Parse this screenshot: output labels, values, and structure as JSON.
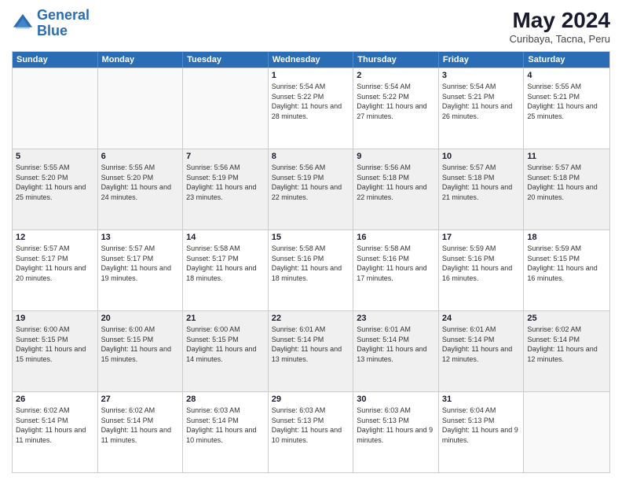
{
  "logo": {
    "line1": "General",
    "line2": "Blue"
  },
  "header": {
    "title": "May 2024",
    "subtitle": "Curibaya, Tacna, Peru"
  },
  "weekdays": [
    "Sunday",
    "Monday",
    "Tuesday",
    "Wednesday",
    "Thursday",
    "Friday",
    "Saturday"
  ],
  "rows": [
    [
      {
        "day": "",
        "sunrise": "",
        "sunset": "",
        "daylight": "",
        "empty": true
      },
      {
        "day": "",
        "sunrise": "",
        "sunset": "",
        "daylight": "",
        "empty": true
      },
      {
        "day": "",
        "sunrise": "",
        "sunset": "",
        "daylight": "",
        "empty": true
      },
      {
        "day": "1",
        "sunrise": "Sunrise: 5:54 AM",
        "sunset": "Sunset: 5:22 PM",
        "daylight": "Daylight: 11 hours and 28 minutes."
      },
      {
        "day": "2",
        "sunrise": "Sunrise: 5:54 AM",
        "sunset": "Sunset: 5:22 PM",
        "daylight": "Daylight: 11 hours and 27 minutes."
      },
      {
        "day": "3",
        "sunrise": "Sunrise: 5:54 AM",
        "sunset": "Sunset: 5:21 PM",
        "daylight": "Daylight: 11 hours and 26 minutes."
      },
      {
        "day": "4",
        "sunrise": "Sunrise: 5:55 AM",
        "sunset": "Sunset: 5:21 PM",
        "daylight": "Daylight: 11 hours and 25 minutes."
      }
    ],
    [
      {
        "day": "5",
        "sunrise": "Sunrise: 5:55 AM",
        "sunset": "Sunset: 5:20 PM",
        "daylight": "Daylight: 11 hours and 25 minutes."
      },
      {
        "day": "6",
        "sunrise": "Sunrise: 5:55 AM",
        "sunset": "Sunset: 5:20 PM",
        "daylight": "Daylight: 11 hours and 24 minutes."
      },
      {
        "day": "7",
        "sunrise": "Sunrise: 5:56 AM",
        "sunset": "Sunset: 5:19 PM",
        "daylight": "Daylight: 11 hours and 23 minutes."
      },
      {
        "day": "8",
        "sunrise": "Sunrise: 5:56 AM",
        "sunset": "Sunset: 5:19 PM",
        "daylight": "Daylight: 11 hours and 22 minutes."
      },
      {
        "day": "9",
        "sunrise": "Sunrise: 5:56 AM",
        "sunset": "Sunset: 5:18 PM",
        "daylight": "Daylight: 11 hours and 22 minutes."
      },
      {
        "day": "10",
        "sunrise": "Sunrise: 5:57 AM",
        "sunset": "Sunset: 5:18 PM",
        "daylight": "Daylight: 11 hours and 21 minutes."
      },
      {
        "day": "11",
        "sunrise": "Sunrise: 5:57 AM",
        "sunset": "Sunset: 5:18 PM",
        "daylight": "Daylight: 11 hours and 20 minutes."
      }
    ],
    [
      {
        "day": "12",
        "sunrise": "Sunrise: 5:57 AM",
        "sunset": "Sunset: 5:17 PM",
        "daylight": "Daylight: 11 hours and 20 minutes."
      },
      {
        "day": "13",
        "sunrise": "Sunrise: 5:57 AM",
        "sunset": "Sunset: 5:17 PM",
        "daylight": "Daylight: 11 hours and 19 minutes."
      },
      {
        "day": "14",
        "sunrise": "Sunrise: 5:58 AM",
        "sunset": "Sunset: 5:17 PM",
        "daylight": "Daylight: 11 hours and 18 minutes."
      },
      {
        "day": "15",
        "sunrise": "Sunrise: 5:58 AM",
        "sunset": "Sunset: 5:16 PM",
        "daylight": "Daylight: 11 hours and 18 minutes."
      },
      {
        "day": "16",
        "sunrise": "Sunrise: 5:58 AM",
        "sunset": "Sunset: 5:16 PM",
        "daylight": "Daylight: 11 hours and 17 minutes."
      },
      {
        "day": "17",
        "sunrise": "Sunrise: 5:59 AM",
        "sunset": "Sunset: 5:16 PM",
        "daylight": "Daylight: 11 hours and 16 minutes."
      },
      {
        "day": "18",
        "sunrise": "Sunrise: 5:59 AM",
        "sunset": "Sunset: 5:15 PM",
        "daylight": "Daylight: 11 hours and 16 minutes."
      }
    ],
    [
      {
        "day": "19",
        "sunrise": "Sunrise: 6:00 AM",
        "sunset": "Sunset: 5:15 PM",
        "daylight": "Daylight: 11 hours and 15 minutes."
      },
      {
        "day": "20",
        "sunrise": "Sunrise: 6:00 AM",
        "sunset": "Sunset: 5:15 PM",
        "daylight": "Daylight: 11 hours and 15 minutes."
      },
      {
        "day": "21",
        "sunrise": "Sunrise: 6:00 AM",
        "sunset": "Sunset: 5:15 PM",
        "daylight": "Daylight: 11 hours and 14 minutes."
      },
      {
        "day": "22",
        "sunrise": "Sunrise: 6:01 AM",
        "sunset": "Sunset: 5:14 PM",
        "daylight": "Daylight: 11 hours and 13 minutes."
      },
      {
        "day": "23",
        "sunrise": "Sunrise: 6:01 AM",
        "sunset": "Sunset: 5:14 PM",
        "daylight": "Daylight: 11 hours and 13 minutes."
      },
      {
        "day": "24",
        "sunrise": "Sunrise: 6:01 AM",
        "sunset": "Sunset: 5:14 PM",
        "daylight": "Daylight: 11 hours and 12 minutes."
      },
      {
        "day": "25",
        "sunrise": "Sunrise: 6:02 AM",
        "sunset": "Sunset: 5:14 PM",
        "daylight": "Daylight: 11 hours and 12 minutes."
      }
    ],
    [
      {
        "day": "26",
        "sunrise": "Sunrise: 6:02 AM",
        "sunset": "Sunset: 5:14 PM",
        "daylight": "Daylight: 11 hours and 11 minutes."
      },
      {
        "day": "27",
        "sunrise": "Sunrise: 6:02 AM",
        "sunset": "Sunset: 5:14 PM",
        "daylight": "Daylight: 11 hours and 11 minutes."
      },
      {
        "day": "28",
        "sunrise": "Sunrise: 6:03 AM",
        "sunset": "Sunset: 5:14 PM",
        "daylight": "Daylight: 11 hours and 10 minutes."
      },
      {
        "day": "29",
        "sunrise": "Sunrise: 6:03 AM",
        "sunset": "Sunset: 5:13 PM",
        "daylight": "Daylight: 11 hours and 10 minutes."
      },
      {
        "day": "30",
        "sunrise": "Sunrise: 6:03 AM",
        "sunset": "Sunset: 5:13 PM",
        "daylight": "Daylight: 11 hours and 9 minutes."
      },
      {
        "day": "31",
        "sunrise": "Sunrise: 6:04 AM",
        "sunset": "Sunset: 5:13 PM",
        "daylight": "Daylight: 11 hours and 9 minutes."
      },
      {
        "day": "",
        "sunrise": "",
        "sunset": "",
        "daylight": "",
        "empty": true
      }
    ]
  ]
}
